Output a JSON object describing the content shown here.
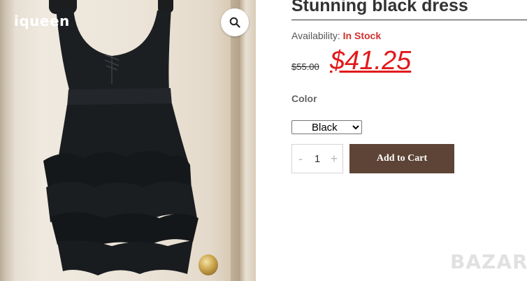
{
  "gallery": {
    "brand": "iqueen",
    "zoom_icon": "search-icon",
    "image_subject": "black-dress-photo"
  },
  "product": {
    "title": "Stunning black dress",
    "availability_label": "Availability:",
    "availability_value": "In Stock",
    "old_price": "$55.00",
    "price": "$41.25",
    "color_label": "Color",
    "color_selected": "Black",
    "quantity": "1",
    "decrease_symbol": "-",
    "increase_symbol": "+",
    "add_to_cart_label": "Add to Cart"
  },
  "watermark": {
    "text": "BAZAR"
  },
  "colors": {
    "price_red": "#e3191b",
    "stock_red": "#d0312d",
    "cart_button_bg": "#5e4436",
    "dress": "#1b1d1f"
  }
}
